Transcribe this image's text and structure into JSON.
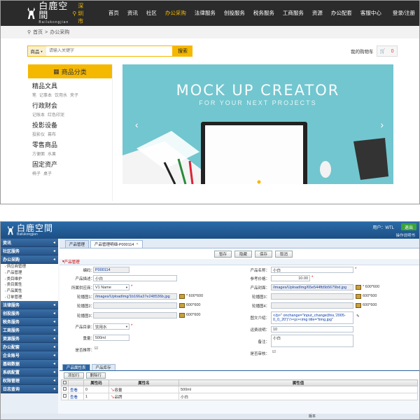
{
  "site": {
    "logo_cn": "白鹿空間",
    "logo_en": "Bailukongjian",
    "city": "深圳市",
    "menu": [
      "首页",
      "资讯",
      "社区",
      "办公采购",
      "法律服务",
      "创投服务",
      "税务服务",
      "工商服务",
      "资源",
      "办公配套",
      "客服中心",
      "登录/注册"
    ],
    "breadcrumb": {
      "home": "首页",
      "sep": ">",
      "current": "办公采购"
    },
    "search": {
      "category": "商品",
      "placeholder": "请输入关键字",
      "button": "搜索"
    },
    "cart": {
      "label": "我的购物车",
      "count": "0"
    },
    "category_title": "商品分类",
    "categories": [
      {
        "title": "精品文具",
        "items": [
          "笔",
          "记事本",
          "饮用水",
          "夹子"
        ]
      },
      {
        "title": "行政财会",
        "items": [
          "记账本",
          "红色印泥"
        ]
      },
      {
        "title": "投影设备",
        "items": [
          "投影仪",
          "幕布"
        ]
      },
      {
        "title": "零售商品",
        "items": [
          "方便面",
          "水果"
        ]
      },
      {
        "title": "固定资产",
        "items": [
          "椅子",
          "桌子"
        ]
      }
    ],
    "banner": {
      "title": "MOCK UP CREATOR",
      "subtitle": "FOR YOUR NEXT PROJECTS"
    },
    "colors": {
      "accent": "#f5b800",
      "nav_bg": "#2b2b2b",
      "banner_bg": "#72c6cf"
    }
  },
  "admin": {
    "logo_cn": "白鹿空間",
    "logo_en": "Bailukongjian",
    "user": "用户：WTL",
    "exit": "退出",
    "manual": "操作说明书",
    "menu": [
      {
        "label": "资讯",
        "expanded": false
      },
      {
        "label": "社区服务",
        "expanded": false
      },
      {
        "label": "办公采购",
        "expanded": true
      }
    ],
    "submenu": [
      "供应商管理",
      "产品管理",
      "类目维护",
      "类目属性",
      "产品属性",
      "订单管理"
    ],
    "menu_rest": [
      "法律服务",
      "创投服务",
      "税务服务",
      "工商服务",
      "资源服务",
      "办公配套",
      "企业账号",
      "基础数据",
      "系统配置",
      "权限管理",
      "日志查询"
    ],
    "tabs": [
      {
        "label": "产品管理"
      },
      {
        "label": "产品管理明细-P000114"
      }
    ],
    "toolbar": [
      "暂存",
      "隐藏",
      "保存",
      "取消"
    ],
    "section": "产品管理",
    "form": {
      "code_label": "编码：",
      "code": "P000114",
      "desc_label": "产品描述：",
      "desc": "小白",
      "supplier_label": "所属供应商：",
      "supplier": "V1 Name",
      "img1_label": "轮播图1：",
      "img1": "/images/UploadImg/1b166a37e248536b.jpg",
      "img_hint": "* 600*600",
      "img2_label": "轮播图2：",
      "img3_label": "轮播图3：",
      "img_size": "600*600",
      "category_label": "产品目录：",
      "category": "饮用水",
      "capacity_label": "重量：",
      "capacity": "500ml",
      "recommend_label": "是否推荐：",
      "name_label": "产品名称：",
      "name": "小白",
      "price_label": "参考价格：",
      "price": "10.00",
      "cover_label": "产品封面：",
      "cover": "/images/UploadImg/65e544fb5b5679bd.jpg",
      "img3b_label": "轮播图3：",
      "img4_label": "轮播图4：",
      "intro_label": "图文介绍：",
      "intro_line1": "</p>\" onchange=\"input_change(this,'2005-",
      "intro_line2": "0_0_20')\"/><p><img title=\"timg.jpg\"",
      "stock_label": "运费说明：",
      "stock": "10",
      "remark_label": "备注：",
      "remark": "小白",
      "audit_label": "是否审核："
    },
    "subtabs": [
      "产品属性表",
      "产品库存"
    ],
    "grid_buttons": [
      "添加行",
      "删除行"
    ],
    "grid_headers": [
      "",
      "属性码",
      "",
      "属性名",
      "属性值"
    ],
    "grid_rows": [
      {
        "link": "查看",
        "code": "0",
        "name": "容量",
        "value": "500ml"
      },
      {
        "link": "查看",
        "code": "1",
        "name": "品牌",
        "value": "小白"
      }
    ],
    "footer": "版本"
  }
}
